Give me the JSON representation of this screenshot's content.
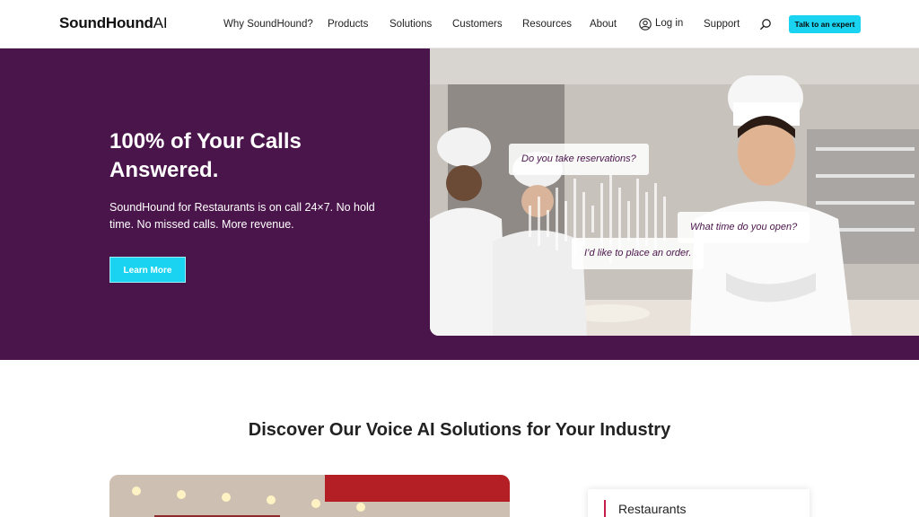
{
  "header": {
    "logo_main": "SoundHound",
    "logo_suffix": "AI",
    "nav": [
      "Why SoundHound?",
      "Products",
      "Solutions",
      "Customers",
      "Resources",
      "About"
    ],
    "login_label": "Log in",
    "support_label": "Support",
    "cta_label": "Talk to an expert"
  },
  "hero": {
    "title": "100% of Your Calls Answered.",
    "subtitle": "SoundHound for Restaurants is on call 24×7. No hold time. No missed calls. More revenue.",
    "button_label": "Learn More",
    "bubbles": [
      "Do you take reservations?",
      "What time do you open?",
      "I’d like to place an order."
    ]
  },
  "section": {
    "title": "Discover Our Voice AI Solutions for Your Industry",
    "active_tab": "Restaurants"
  },
  "colors": {
    "hero_bg": "#4a154b",
    "accent_cyan": "#19d3f0",
    "tab_marker": "#c41f4b"
  },
  "icons": [
    "user-circle-icon",
    "search-icon"
  ]
}
